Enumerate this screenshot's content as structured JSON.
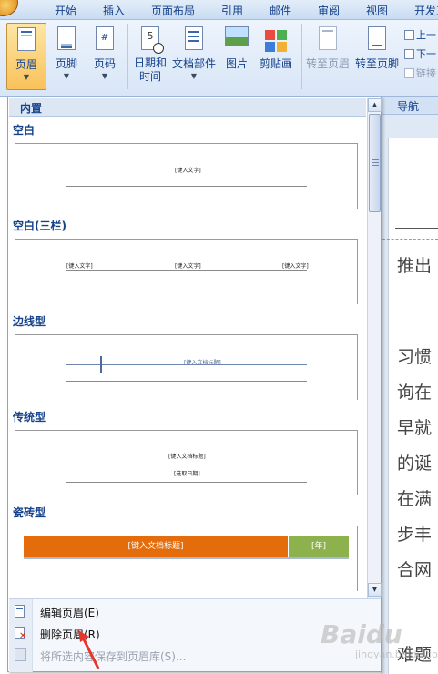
{
  "ribbon_tabs": [
    "开始",
    "插入",
    "页面布局",
    "引用",
    "邮件",
    "审阅",
    "视图",
    "开发工"
  ],
  "ribbon_buttons": {
    "header": "页眉",
    "footer": "页脚",
    "page_number": "页码",
    "datetime_line1": "日期和",
    "datetime_line2": "时间",
    "quick_parts": "文档部件",
    "picture": "图片",
    "clip_art": "剪贴画",
    "goto_header": "转至页眉",
    "goto_footer": "转至页脚",
    "previous": "上一",
    "next": "下一",
    "link": "链接"
  },
  "group_labels": {
    "navigation": "导航"
  },
  "gallery": {
    "section": "内置",
    "items": [
      {
        "title": "空白",
        "placeholders": [
          "[键入文字]"
        ]
      },
      {
        "title": "空白(三栏)",
        "placeholders": [
          "[键入文字]",
          "[键入文字]",
          "[键入文字]"
        ]
      },
      {
        "title": "边线型",
        "placeholders": [
          "[键入文档标题]"
        ]
      },
      {
        "title": "传统型",
        "placeholders": [
          "[键入文档标题]",
          "[选取日期]"
        ]
      },
      {
        "title": "瓷砖型",
        "placeholders": [
          "[键入文档标题]",
          "[年]"
        ]
      }
    ]
  },
  "menu": {
    "edit_header": "编辑页眉(E)",
    "remove_header": "删除页眉(R)",
    "save_selection": "将所选内容保存到页眉库(S)..."
  },
  "document_text": [
    "推出",
    "习惯",
    "询在",
    "早就",
    "的诞",
    "在满",
    "步丰",
    "合网",
    "难题"
  ],
  "watermark": {
    "brand": "Baidu",
    "sub": "jingyan.baidu.com"
  },
  "colors": {
    "tile_orange": "#e46c0a",
    "tile_green": "#8db14d",
    "active_button": "#f9c25a",
    "annotation_arrow": "#e8352a"
  }
}
